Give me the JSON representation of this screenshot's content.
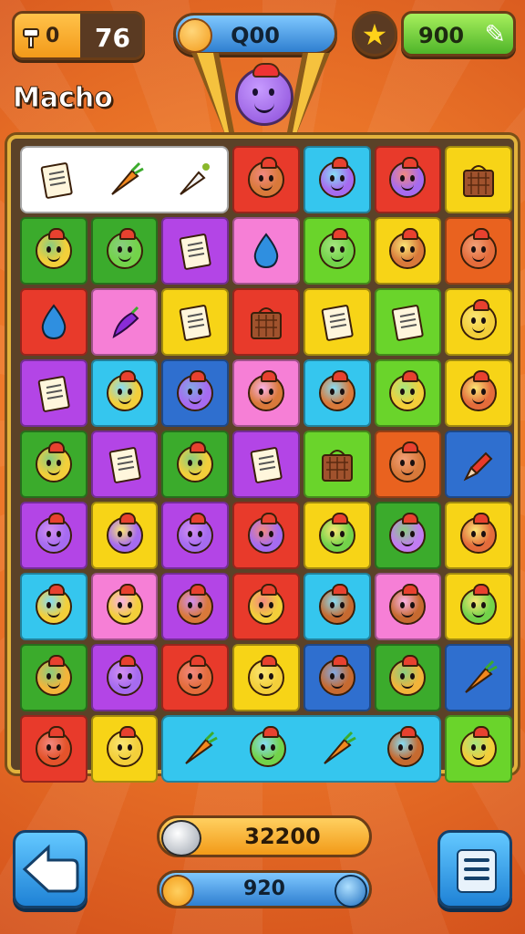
{
  "hud": {
    "moves_small": "0",
    "moves_big": "76",
    "score": "Q00",
    "gems": "900"
  },
  "player": {
    "name": "Macho"
  },
  "bottom": {
    "total": "32200",
    "level_bar": "920"
  },
  "board": {
    "rows": [
      [
        {
          "span": 3,
          "bg": "#ffffff",
          "items": [
            "paper",
            "carrot",
            "paint-brush"
          ]
        },
        {
          "bg": "#e83a2b",
          "items": [
            "face:#d9793a"
          ]
        },
        {
          "bg": "#35c6ee",
          "items": [
            "face:#a66bf0"
          ]
        },
        {
          "bg": "#e83a2b",
          "items": [
            "face:#a66bf0"
          ]
        },
        {
          "bg": "#f7d417",
          "items": [
            "basket"
          ]
        }
      ],
      [
        {
          "bg": "#3bab2c",
          "items": [
            "face:#f3cf3a"
          ]
        },
        {
          "bg": "#3bab2c",
          "items": [
            "face:#73d34a"
          ]
        },
        {
          "bg": "#b345e6",
          "items": [
            "paper"
          ]
        },
        {
          "bg": "#f67fd6",
          "items": [
            "drop"
          ]
        },
        {
          "bg": "#6ad42b",
          "items": [
            "face:#73d34a"
          ]
        },
        {
          "bg": "#f7d417",
          "items": [
            "face:#d9793a"
          ]
        },
        {
          "bg": "#e9621f",
          "items": [
            "face:#e46c3b"
          ]
        }
      ],
      [
        {
          "bg": "#e83a2b",
          "items": [
            "drop"
          ]
        },
        {
          "bg": "#f67fd6",
          "items": [
            "pepper"
          ]
        },
        {
          "bg": "#f7d417",
          "items": [
            "paper"
          ]
        },
        {
          "bg": "#e83a2b",
          "items": [
            "basket"
          ]
        },
        {
          "bg": "#f7d417",
          "items": [
            "paper"
          ]
        },
        {
          "bg": "#6ad42b",
          "items": [
            "paper"
          ]
        },
        {
          "bg": "#f7d417",
          "items": [
            "face:#f3cf3a"
          ]
        }
      ],
      [
        {
          "bg": "#b345e6",
          "items": [
            "paper"
          ]
        },
        {
          "bg": "#35c6ee",
          "items": [
            "face:#f3cf3a"
          ]
        },
        {
          "bg": "#2f6fcf",
          "items": [
            "face:#a66bf0"
          ]
        },
        {
          "bg": "#f67fd6",
          "items": [
            "face:#d9793a"
          ]
        },
        {
          "bg": "#35c6ee",
          "items": [
            "face:#d9793a"
          ]
        },
        {
          "bg": "#6ad42b",
          "items": [
            "face:#f3cf3a"
          ]
        },
        {
          "bg": "#f7d417",
          "items": [
            "face:#e46c3b"
          ]
        }
      ],
      [
        {
          "bg": "#3bab2c",
          "items": [
            "face:#f3cf3a"
          ]
        },
        {
          "bg": "#b345e6",
          "items": [
            "paper"
          ]
        },
        {
          "bg": "#3bab2c",
          "items": [
            "face:#f3cf3a"
          ]
        },
        {
          "bg": "#b345e6",
          "items": [
            "paper"
          ]
        },
        {
          "bg": "#6ad42b",
          "items": [
            "basket"
          ]
        },
        {
          "bg": "#e9621f",
          "items": [
            "face:#d9793a"
          ]
        },
        {
          "bg": "#2f6fcf",
          "items": [
            "crayon"
          ]
        }
      ],
      [
        {
          "bg": "#b345e6",
          "items": [
            "face:#a66bf0"
          ]
        },
        {
          "bg": "#f7d417",
          "items": [
            "face:#a66bf0"
          ]
        },
        {
          "bg": "#b345e6",
          "items": [
            "face:#a66bf0"
          ]
        },
        {
          "bg": "#e83a2b",
          "items": [
            "face:#a66bf0"
          ]
        },
        {
          "bg": "#f7d417",
          "items": [
            "face:#73d34a"
          ]
        },
        {
          "bg": "#3bab2c",
          "items": [
            "face:#c27cf2"
          ]
        },
        {
          "bg": "#f7d417",
          "items": [
            "face:#e46c3b"
          ]
        }
      ],
      [
        {
          "bg": "#35c6ee",
          "items": [
            "face:#f3cf3a"
          ]
        },
        {
          "bg": "#f67fd6",
          "items": [
            "face:#f3cf3a"
          ]
        },
        {
          "bg": "#b345e6",
          "items": [
            "face:#d9793a"
          ]
        },
        {
          "bg": "#e83a2b",
          "items": [
            "face:#f3cf3a"
          ]
        },
        {
          "bg": "#35c6ee",
          "items": [
            "face:#c66a30"
          ]
        },
        {
          "bg": "#f67fd6",
          "items": [
            "face:#c66a30"
          ]
        },
        {
          "bg": "#f7d417",
          "items": [
            "face:#73d34a"
          ]
        }
      ],
      [
        {
          "bg": "#3bab2c",
          "items": [
            "face:#f3b43a"
          ]
        },
        {
          "bg": "#b345e6",
          "items": [
            "face:#a66bf0"
          ]
        },
        {
          "bg": "#e83a2b",
          "items": [
            "face:#e46c3b"
          ]
        },
        {
          "bg": "#f7d417",
          "items": [
            "face:#f3cf3a"
          ]
        },
        {
          "bg": "#2f6fcf",
          "items": [
            "face:#c66a30"
          ]
        },
        {
          "bg": "#3bab2c",
          "items": [
            "face:#f3b43a"
          ]
        },
        {
          "bg": "#2f6fcf",
          "items": [
            "carrot"
          ]
        }
      ],
      [
        {
          "bg": "#e83a2b",
          "items": [
            "face:#e4532b"
          ]
        },
        {
          "bg": "#f7d417",
          "items": [
            "face:#f3cf3a"
          ]
        },
        {
          "span": 4,
          "bg": "#35c6ee",
          "items": [
            "carrot",
            "face:#73d34a",
            "carrot",
            "face:#c66a30"
          ]
        },
        {
          "bg": "#6ad42b",
          "items": [
            "face:#f3cf3a"
          ]
        }
      ]
    ]
  }
}
